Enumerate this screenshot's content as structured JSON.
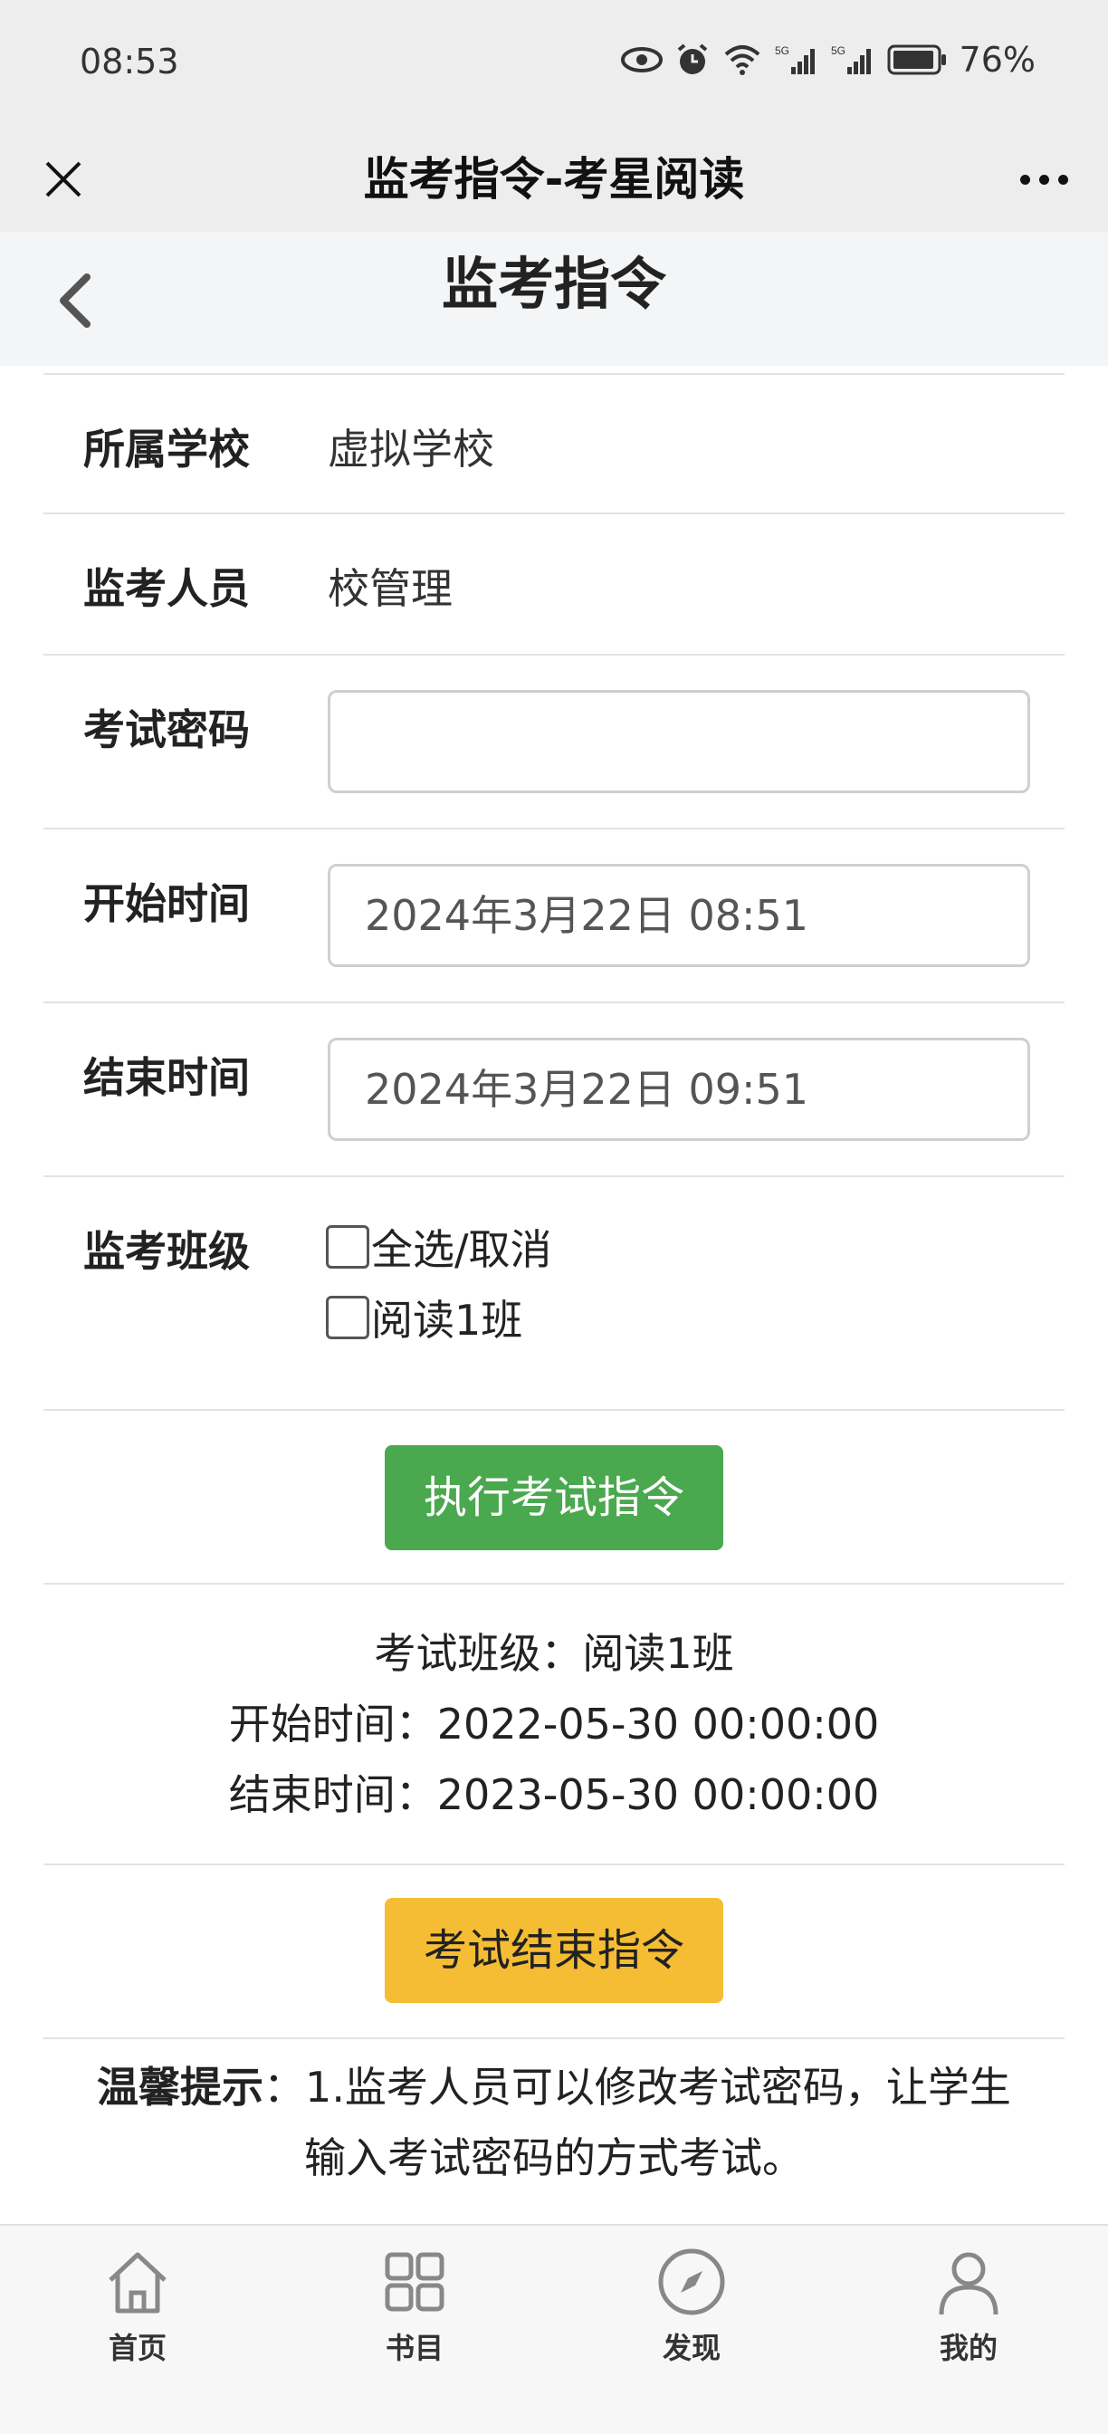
{
  "status_bar": {
    "time": "08:53",
    "battery": "76%",
    "icons": [
      "eye-icon",
      "alarm-icon",
      "wifi-icon",
      "signal-icon",
      "signal-icon",
      "battery-icon"
    ]
  },
  "wechat_bar": {
    "title": "监考指令-考星阅读",
    "close_icon": "close-icon",
    "more_icon": "more-icon"
  },
  "header": {
    "title": "监考指令",
    "back_icon": "chevron-left-icon"
  },
  "form": {
    "school_label": "所属学校",
    "school_value": "虚拟学校",
    "proctor_label": "监考人员",
    "proctor_value": "校管理",
    "password_label": "考试密码",
    "password_value": "",
    "start_label": "开始时间",
    "start_value": "2024年3月22日 08:51",
    "end_label": "结束时间",
    "end_value": "2024年3月22日 09:51",
    "class_label": "监考班级",
    "class_options": [
      {
        "label": "全选/取消",
        "checked": false
      },
      {
        "label": "阅读1班",
        "checked": false
      }
    ]
  },
  "actions": {
    "execute_label": "执行考试指令",
    "end_label": "考试结束指令"
  },
  "current_exam": {
    "class_line": "考试班级：阅读1班",
    "start_line": "开始时间：2022-05-30 00:00:00",
    "end_line": "结束时间：2023-05-30 00:00:00"
  },
  "tip": {
    "title": "温馨提示",
    "text": "：1.监考人员可以修改考试密码，让学生输入考试密码的方式考试。"
  },
  "bottom_nav": [
    {
      "label": "首页",
      "icon": "home-icon"
    },
    {
      "label": "书目",
      "icon": "grid-icon"
    },
    {
      "label": "发现",
      "icon": "compass-icon"
    },
    {
      "label": "我的",
      "icon": "user-icon"
    }
  ],
  "colors": {
    "execute_button": "#4aa84e",
    "end_button": "#f5bd33",
    "bar_background": "#ededed"
  }
}
